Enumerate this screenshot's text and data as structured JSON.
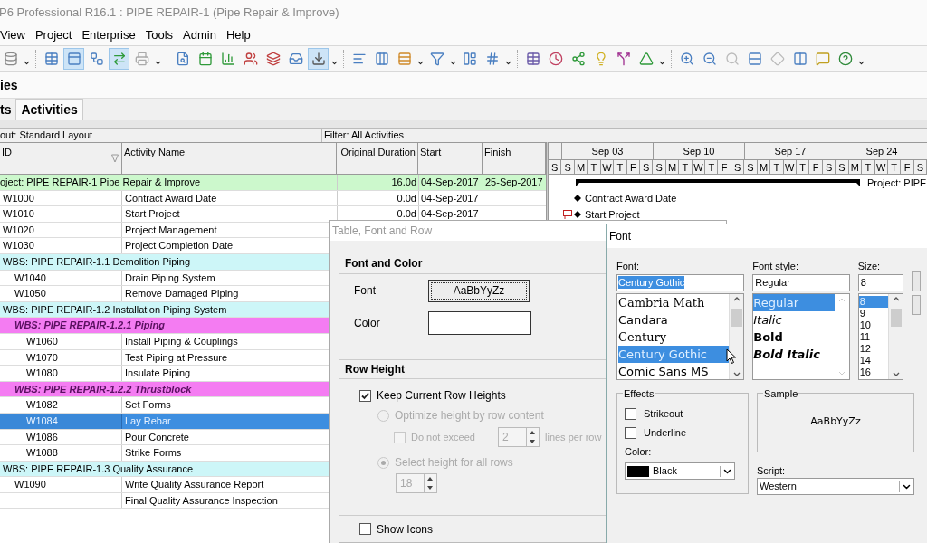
{
  "window": {
    "title": "P6 Professional R16.1 : PIPE REPAIR-1 (Pipe Repair & Improve)"
  },
  "menu": [
    "View",
    "Project",
    "Enterprise",
    "Tools",
    "Admin",
    "Help"
  ],
  "toolbar": [
    {
      "pressed": false
    },
    {
      "pressed": false
    },
    {
      "pressed": true
    },
    {
      "pressed": false
    },
    {
      "pressed": true
    },
    {
      "pressed": false
    },
    {
      "pressed": false
    },
    {
      "pressed": false
    },
    {
      "pressed": false
    },
    {
      "pressed": false
    },
    {
      "pressed": false
    },
    {
      "pressed": false
    },
    {
      "pressed": true
    },
    {
      "pressed": false
    },
    {
      "pressed": false
    },
    {
      "pressed": false
    },
    {
      "pressed": false
    },
    {
      "pressed": false
    },
    {
      "pressed": false
    },
    {
      "pressed": false
    },
    {
      "pressed": false
    },
    {
      "pressed": false
    },
    {
      "pressed": false
    },
    {
      "pressed": false
    },
    {
      "pressed": false
    },
    {
      "pressed": false
    },
    {
      "pressed": false
    },
    {
      "pressed": false
    },
    {
      "pressed": false
    },
    {
      "pressed": false
    },
    {
      "pressed": false
    },
    {
      "pressed": false
    },
    {
      "pressed": false
    }
  ],
  "section_title": "ies",
  "tabs": [
    {
      "label": "ts",
      "selected": false
    },
    {
      "label": "Activities",
      "selected": true
    }
  ],
  "layout_bar": {
    "layout": "out: Standard Layout",
    "filter": "Filter: All Activities"
  },
  "table": {
    "columns": [
      "ID",
      "Activity Name",
      "Original Duration",
      "Start",
      "Finish"
    ],
    "rows": [
      {
        "kind": "project",
        "label": "oject: PIPE REPAIR-1  Pipe Repair & Improve",
        "duration": "16.0d",
        "start": "04-Sep-2017",
        "finish": "25-Sep-2017",
        "color": "#ccf8cc",
        "bar_label": "Project: PIPE",
        "children": [
          {
            "kind": "activity",
            "id": "W1000",
            "name": "Contract Award Date",
            "duration": "0.0d",
            "start": "04-Sep-2017",
            "selected": false,
            "bar_label": "Contract Award Date"
          },
          {
            "kind": "activity",
            "id": "W1010",
            "name": "Start Project",
            "duration": "0.0d",
            "start": "04-Sep-2017",
            "selected": false,
            "bar_label": "Start Project"
          },
          {
            "kind": "activity",
            "id": "W1020",
            "name": "Project Management",
            "selected": false
          },
          {
            "kind": "activity",
            "id": "W1030",
            "name": "Project Completion Date",
            "selected": false
          },
          {
            "kind": "wbs",
            "label": "WBS: PIPE REPAIR-1.1  Demolition Piping",
            "color": "#cdf6f8",
            "children": [
              {
                "kind": "activity",
                "id": "W1040",
                "name": "Drain Piping System",
                "selected": false
              },
              {
                "kind": "activity",
                "id": "W1050",
                "name": "Remove Damaged Piping",
                "selected": false
              }
            ]
          },
          {
            "kind": "wbs",
            "label": "WBS: PIPE REPAIR-1.2  Installation Piping System",
            "color": "#cdf6f8",
            "children": [
              {
                "kind": "wbs",
                "label": "WBS: PIPE REPAIR-1.2.1  Piping",
                "color": "#f47cf2",
                "children": [
                  {
                    "kind": "activity",
                    "id": "W1060",
                    "name": "Install Piping & Couplings",
                    "selected": false
                  },
                  {
                    "kind": "activity",
                    "id": "W1070",
                    "name": "Test Piping at Pressure",
                    "selected": false
                  },
                  {
                    "kind": "activity",
                    "id": "W1080",
                    "name": "Insulate Piping",
                    "selected": false
                  }
                ]
              },
              {
                "kind": "wbs",
                "label": "WBS: PIPE REPAIR-1.2.2  Thrustblock",
                "color": "#f47cf2",
                "children": [
                  {
                    "kind": "activity",
                    "id": "W1082",
                    "name": "Set Forms",
                    "selected": false
                  },
                  {
                    "kind": "activity",
                    "id": "W1084",
                    "name": "Lay Rebar",
                    "selected": true
                  },
                  {
                    "kind": "activity",
                    "id": "W1086",
                    "name": "Pour Concrete",
                    "selected": false
                  },
                  {
                    "kind": "activity",
                    "id": "W1088",
                    "name": "Strike Forms",
                    "selected": false
                  }
                ]
              }
            ]
          },
          {
            "kind": "wbs",
            "label": "WBS: PIPE REPAIR-1.3  Quality Assurance",
            "color": "#cdf6f8",
            "children": [
              {
                "kind": "activity",
                "id": "W1090",
                "name": "Write Quality Assurance Report",
                "selected": false
              },
              {
                "kind": "activity",
                "name": "Final Quality Assurance Inspection",
                "selected": false
              }
            ]
          }
        ]
      }
    ]
  },
  "gantt": {
    "weeks": [
      "Sep 03",
      "Sep 10",
      "Sep 17",
      "Sep 24"
    ],
    "days": [
      "S",
      "S",
      "M",
      "T",
      "W",
      "T",
      "F",
      "S",
      "S",
      "M",
      "T",
      "W",
      "T",
      "F",
      "S",
      "S",
      "M",
      "T",
      "W",
      "T",
      "F",
      "S",
      "S",
      "M",
      "T",
      "W",
      "T",
      "F",
      "S"
    ]
  },
  "table_dialog": {
    "title": "Table, Font and Row",
    "font_and_color": {
      "title": "Font and Color",
      "font_label": "Font",
      "font_sample": "AaBbYyZz",
      "color_label": "Color"
    },
    "row_height": {
      "title": "Row Height",
      "keep_current": {
        "label": "Keep Current Row Heights",
        "checked": true
      },
      "optimize": {
        "label": "Optimize height by row content",
        "selected": false,
        "disabled": true
      },
      "do_not_exceed": {
        "label": "Do not exceed",
        "checked": false,
        "disabled": true,
        "value": "2",
        "suffix": "lines per row"
      },
      "select_height": {
        "label": "Select height for all rows",
        "selected": true,
        "disabled": true,
        "value": "18"
      }
    },
    "show_icons": {
      "label": "Show Icons",
      "checked": false
    }
  },
  "font_dialog": {
    "title": "Font",
    "font": {
      "label": "Font:",
      "value": "Century Gothic",
      "items": [
        {
          "label": "Cambria Math",
          "kind": "serif",
          "selected": false
        },
        {
          "label": "Candara",
          "kind": "sans",
          "selected": false
        },
        {
          "label": "Century",
          "kind": "serif",
          "selected": false
        },
        {
          "label": "Century Gothic",
          "kind": "sans",
          "selected": true
        },
        {
          "label": "Comic Sans MS",
          "kind": "sans",
          "selected": false
        }
      ]
    },
    "style": {
      "label": "Font style:",
      "value": "Regular",
      "items": [
        {
          "label": "Regular",
          "kind": "regular",
          "selected": true
        },
        {
          "label": "Italic",
          "kind": "italic",
          "selected": false
        },
        {
          "label": "Bold",
          "kind": "bold",
          "selected": false
        },
        {
          "label": "Bold Italic",
          "kind": "bold-italic",
          "selected": false
        }
      ]
    },
    "size": {
      "label": "Size:",
      "value": "8",
      "items": [
        {
          "label": "8",
          "selected": true
        },
        {
          "label": "9",
          "selected": false
        },
        {
          "label": "10",
          "selected": false
        },
        {
          "label": "11",
          "selected": false
        },
        {
          "label": "12",
          "selected": false
        },
        {
          "label": "14",
          "selected": false
        },
        {
          "label": "16",
          "selected": false
        }
      ]
    },
    "effects": {
      "title": "Effects",
      "strikeout": {
        "label": "Strikeout",
        "checked": false
      },
      "underline": {
        "label": "Underline",
        "checked": false
      },
      "color_label": "Color:",
      "color_value": "Black",
      "color": "#000000"
    },
    "sample": {
      "title": "Sample",
      "text": "AaBbYyZz"
    },
    "script": {
      "label": "Script:",
      "value": "Western"
    }
  }
}
